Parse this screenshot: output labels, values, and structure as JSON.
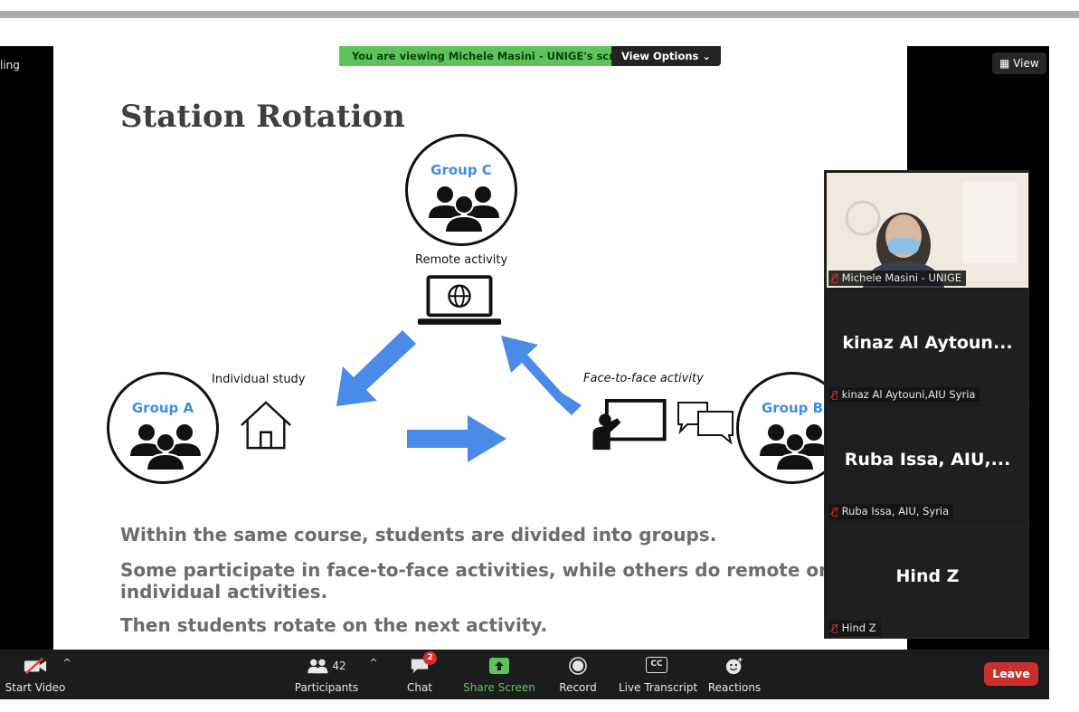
{
  "banner": {
    "viewing_text": "You are viewing Michele Masini - UNIGE's screen",
    "view_options_label": "View Options"
  },
  "top_right": {
    "view_label": "View"
  },
  "edge_label": "ling",
  "slide": {
    "title": "Station Rotation",
    "group_c": "Group C",
    "group_a": "Group A",
    "group_b": "Group B",
    "remote_activity": "Remote activity",
    "individual_study": "Individual study",
    "face_to_face": "Face-to-face activity",
    "bullets": [
      "Within the same course, students are divided into groups.",
      "Some participate in face-to-face activities, while others do remote or",
      "individual activities.",
      "Then students rotate on the next activity."
    ]
  },
  "gallery": {
    "tiles": [
      {
        "display_name": "",
        "label": "Michele Masini - UNIGE"
      },
      {
        "display_name": "kinaz Al Aytoun...",
        "label": "kinaz Al Aytouni,AIU Syria"
      },
      {
        "display_name": "Ruba Issa, AIU,...",
        "label": "Ruba Issa, AIU, Syria"
      },
      {
        "display_name": "Hind Z",
        "label": "Hind Z"
      }
    ]
  },
  "toolbar": {
    "start_video": "Start Video",
    "participants": "Participants",
    "participants_count": "42",
    "chat": "Chat",
    "chat_badge": "2",
    "share_screen": "Share Screen",
    "record": "Record",
    "live_transcript": "Live Transcript",
    "reactions": "Reactions",
    "leave": "Leave",
    "cc_icon_text": "CC"
  },
  "colors": {
    "share_green": "#5cc55a",
    "leave_red": "#c9302c",
    "group_blue": "#3f8edb",
    "arrow_blue": "#4a8ae8"
  }
}
